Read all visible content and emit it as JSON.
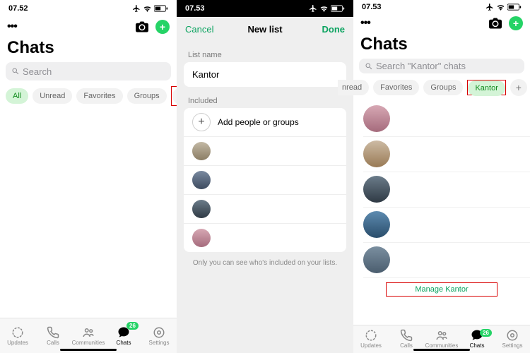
{
  "status": {
    "time1": "07.52",
    "time2": "07.53",
    "time3": "07.53"
  },
  "p1": {
    "title": "Chats",
    "search_placeholder": "Search",
    "pills": {
      "all": "All",
      "unread": "Unread",
      "favorites": "Favorites",
      "groups": "Groups"
    }
  },
  "p2": {
    "cancel": "Cancel",
    "title": "New list",
    "done": "Done",
    "listname_label": "List name",
    "listname_value": "Kantor",
    "included_label": "Included",
    "add_label": "Add people or groups",
    "hint": "Only you can see who's included on your lists."
  },
  "p3": {
    "title": "Chats",
    "search_placeholder": "Search \"Kantor\" chats",
    "pills": {
      "unread_half": "nread",
      "favorites": "Favorites",
      "groups": "Groups",
      "kantor": "Kantor"
    },
    "manage": "Manage Kantor"
  },
  "tabs": {
    "updates": "Updates",
    "calls": "Calls",
    "communities": "Communities",
    "chats": "Chats",
    "settings": "Settings",
    "badge": "26"
  }
}
